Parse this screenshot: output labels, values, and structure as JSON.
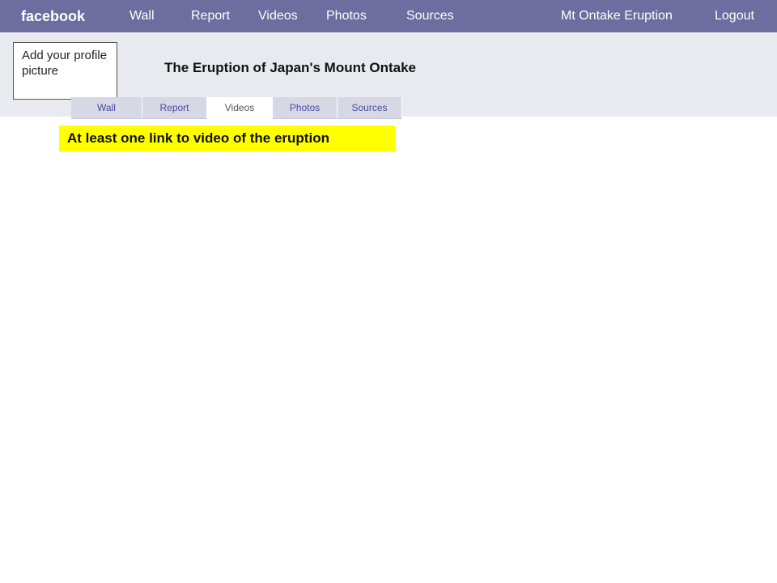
{
  "topnav": {
    "brand": "facebook",
    "links": [
      "Wall",
      "Report",
      "Videos",
      "Photos",
      "Sources"
    ],
    "page_name": "Mt Ontake Eruption",
    "logout": "Logout"
  },
  "profile": {
    "placeholder_text": "Add your profile picture"
  },
  "page": {
    "title": "The Eruption of Japan's Mount Ontake"
  },
  "tabs": {
    "items": [
      "Wall",
      "Report",
      "Videos",
      "Photos",
      "Sources"
    ],
    "active": "Videos"
  },
  "content": {
    "note": "At least one link to video of the eruption"
  },
  "colors": {
    "topbar": "#6d6d9f",
    "header_bg": "#e9eaf0",
    "highlight": "#ffff00"
  }
}
